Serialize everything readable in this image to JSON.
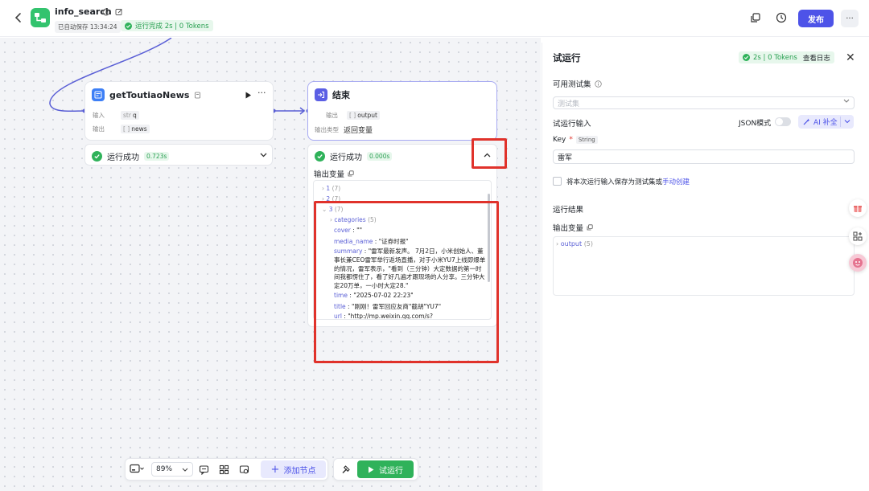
{
  "app": {
    "title": "info_search",
    "saved_text": "已自动保存 13:34:24",
    "run_status": "运行完成 2s | 0 Tokens",
    "publish_label": "发布",
    "more_label": "···"
  },
  "nodes": {
    "news": {
      "title": "getToutiaoNews",
      "input_label": "输入",
      "input_type": "str",
      "input_value": "q",
      "output_label": "输出",
      "output_type": "[ ]",
      "output_value": "news",
      "status_label": "运行成功",
      "status_time": "0.723s"
    },
    "end": {
      "title": "结束",
      "output_label": "输出",
      "output_type": "[ ]",
      "output_value": "output",
      "output_kind_label": "输出类型",
      "output_kind_value": "返回变量",
      "status_label": "运行成功",
      "status_time": "0.000s",
      "output_vars_label": "输出变量"
    }
  },
  "output_tree": {
    "item1": "1",
    "item1_count": "(7)",
    "item2": "2",
    "item2_count": "(7)",
    "item3": "3",
    "item3_count": "(7)",
    "categories_key": "categories",
    "categories_count": "(5)",
    "cover_key": "cover",
    "cover_val": "\"\"",
    "media_key": "media_name",
    "media_val": "\"证券时报\"",
    "summary_key": "summary",
    "summary_val": "\"雷军最新发声。 7月2日，小米创始人、董事长兼CEO雷军举行返场直播，对于小米YU7上线即爆单的情况，雷军表示，\"看到（三分钟）大定数据的第一时间我都愣住了，看了好几遍才跟现场的人分享。三分钟大定20万单，一小时大定28.\"",
    "time_key": "time",
    "time_val": "\"2025-07-02 22:23\"",
    "title_key": "title",
    "title_val": "\"刚刚！雷军回应友商\"截胡\"YU7\"",
    "url_key": "url",
    "url_val": "\"http://mp.weixin.qq.com/s?"
  },
  "toolbar": {
    "zoom": "89%",
    "add_node_label": "添加节点",
    "run_label": "试运行"
  },
  "panel": {
    "title": "试运行",
    "badge": "2s | 0 Tokens",
    "log_link": "查看日志",
    "testset_label": "可用测试集",
    "testset_placeholder": "测试集",
    "input_section": "试运行输入",
    "json_mode": "JSON模式",
    "ai_fill": "AI 补全",
    "key_label": "Key",
    "key_type": "String",
    "key_value": "雷军",
    "save_text": "将本次运行输入保存为测试集或",
    "save_link": "手动创建",
    "result_label": "运行结果",
    "output_vars_label": "输出变量",
    "result_key": "output",
    "result_count": "(5)"
  },
  "colors": {
    "accent": "#4d53e8",
    "success": "#2fb25a",
    "highlight": "#e0322b"
  }
}
